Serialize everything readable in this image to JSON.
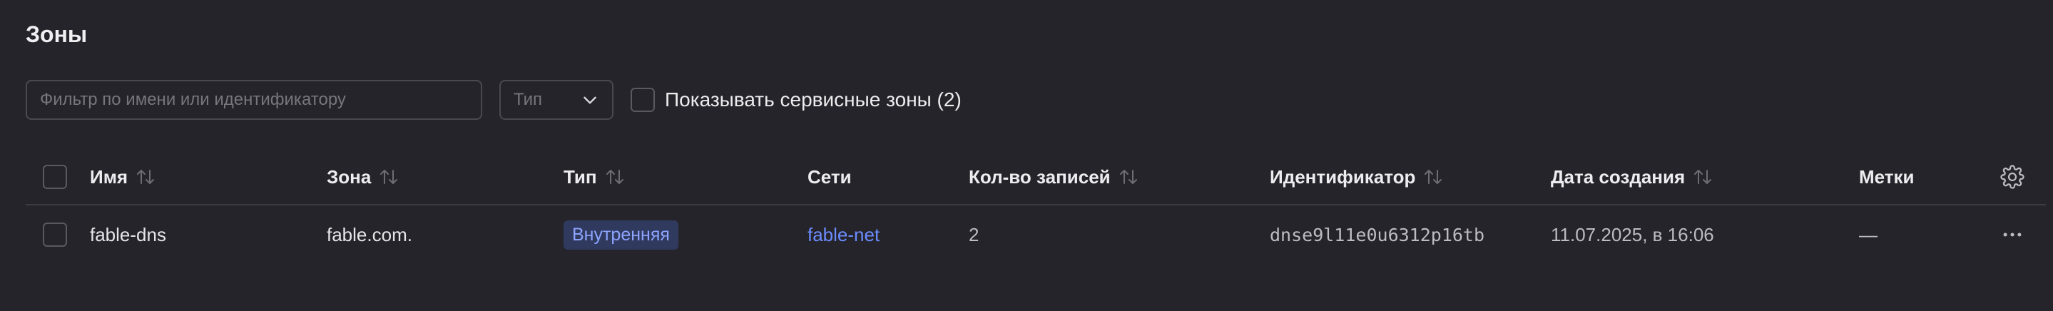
{
  "page": {
    "title": "Зоны"
  },
  "toolbar": {
    "filter_placeholder": "Фильтр по имени или идентификатору",
    "filter_value": "",
    "type_select_placeholder": "Тип",
    "service_zones_label": "Показывать сервисные зоны (2)",
    "service_zones_checked": false
  },
  "table": {
    "columns": {
      "name": "Имя",
      "zone": "Зона",
      "type": "Тип",
      "networks": "Сети",
      "record_count": "Кол-во записей",
      "identifier": "Идентификатор",
      "created": "Дата создания",
      "labels": "Метки"
    },
    "rows": [
      {
        "name": "fable-dns",
        "zone": "fable.com.",
        "type": "Внутренняя",
        "networks": "fable-net",
        "record_count": "2",
        "identifier": "dnse9l11e0u6312p16tb",
        "created": "11.07.2025, в 16:06",
        "labels": "—"
      }
    ]
  },
  "icons": {
    "sort": "sort-arrows-icon",
    "chevron": "chevron-down-icon",
    "settings": "gear-icon",
    "more": "more-dots-icon"
  },
  "colors": {
    "background": "#25242a",
    "badge_bg": "#2f3a5e",
    "badge_text": "#8ea4ff",
    "link": "#6b8cff"
  }
}
